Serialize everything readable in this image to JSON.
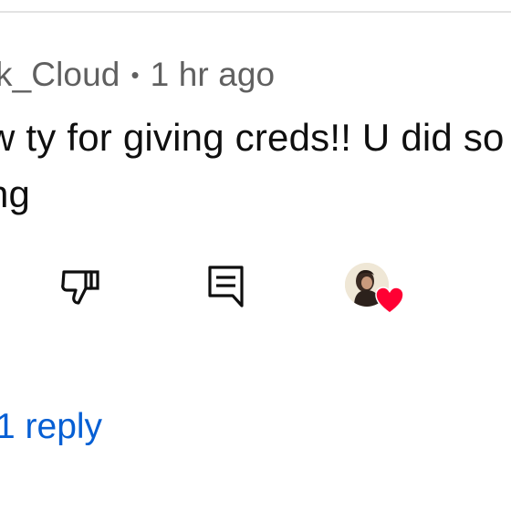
{
  "comment": {
    "author": "k_Cloud",
    "separator": "•",
    "timestamp": "1 hr ago",
    "text_line1": "w ty for giving creds!! U did so",
    "text_line2": "ng"
  },
  "actions": {
    "dislike_icon": "thumbs-down-icon",
    "reply_icon": "comment-reply-icon",
    "creator_heart_icon": "creator-heart-icon"
  },
  "replies": {
    "label": "1 reply"
  },
  "colors": {
    "meta": "#606060",
    "text": "#0f0f0f",
    "link": "#065fd4",
    "heart": "#ff0033",
    "divider": "#e3e3e3"
  }
}
